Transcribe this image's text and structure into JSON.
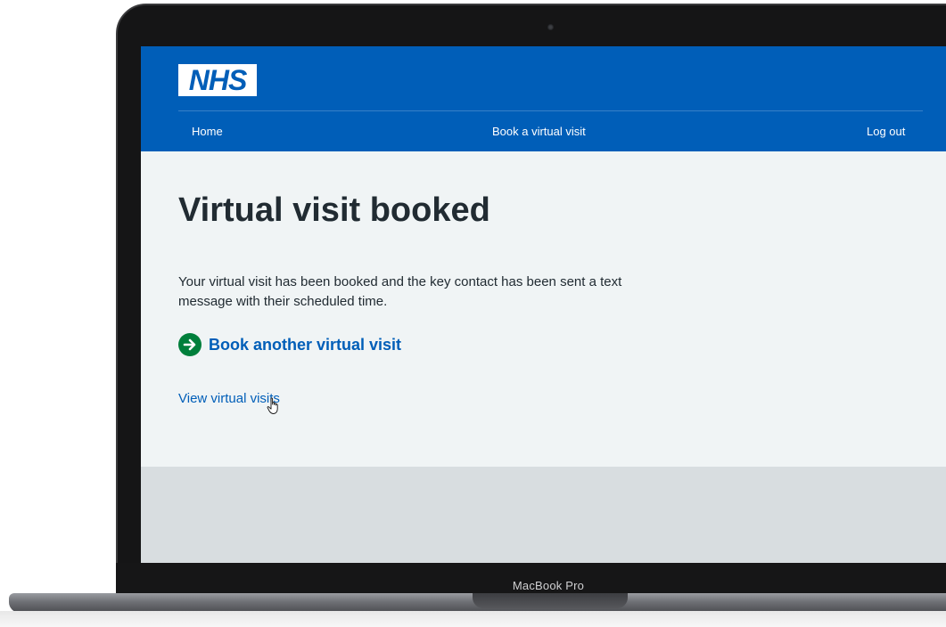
{
  "device": {
    "model_label": "MacBook Pro"
  },
  "header": {
    "logo_text": "NHS",
    "nav": {
      "home": "Home",
      "book": "Book a virtual visit",
      "logout": "Log out"
    }
  },
  "main": {
    "title": "Virtual visit booked",
    "body": "Your virtual visit has been booked and the key contact has been sent a text message with their scheduled time.",
    "action_link": "Book another virtual visit",
    "secondary_link": "View virtual visits"
  },
  "colors": {
    "nhs_blue": "#005eb8",
    "nhs_green": "#007f3b",
    "text": "#212b32",
    "background": "#f0f4f5"
  },
  "icons": {
    "action_arrow": "arrow-right-circle-icon",
    "mouse_cursor": "hand-pointer-icon"
  }
}
